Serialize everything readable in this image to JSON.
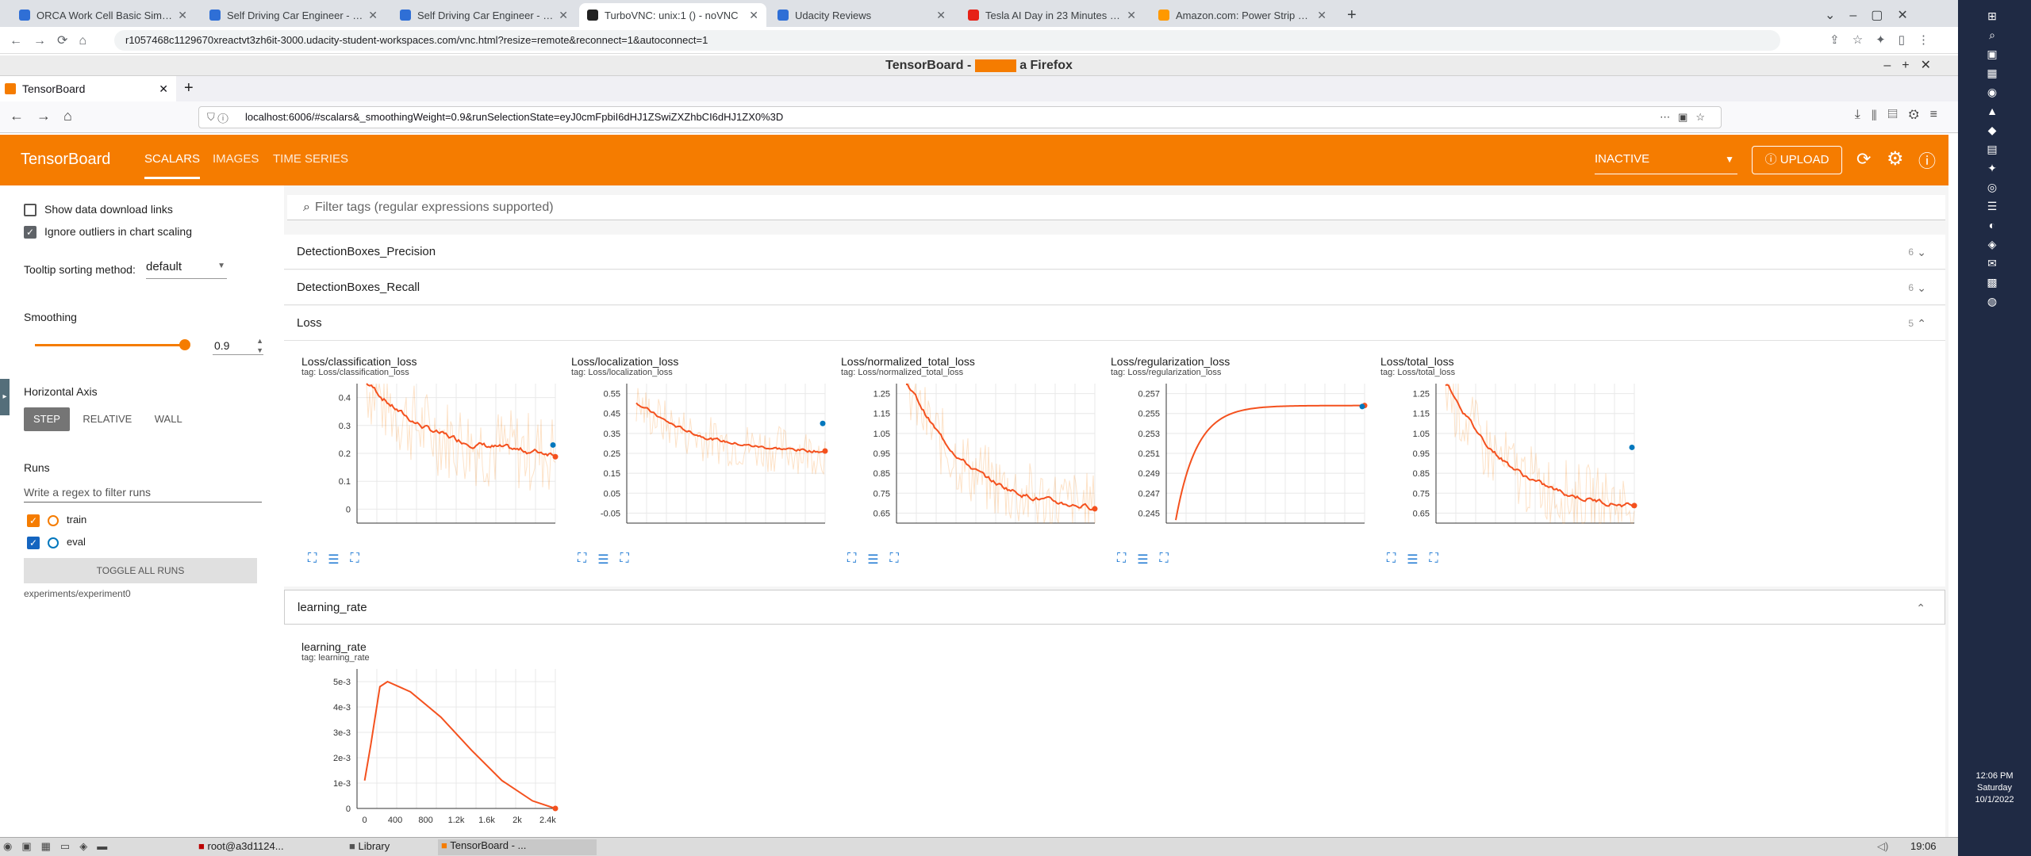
{
  "chrome": {
    "tabs": [
      "ORCA Work Cell Basic Simulatio",
      "Self Driving Car Engineer - Udac",
      "Self Driving Car Engineer - Udac",
      "TurboVNC: unix:1 () - noVNC",
      "Udacity Reviews",
      "Tesla AI Day in 23 Minutes (Supe",
      "Amazon.com: Power Strip with 6"
    ],
    "url": "r1057468c1129670xreactvt3zh6it-3000.udacity-student-workspaces.com/vnc.html?resize=remote&reconnect=1&autoconnect=1"
  },
  "firefox": {
    "window_title_left": "TensorBoard -",
    "window_title_right": "a Firefox",
    "tab_title": "TensorBoard",
    "url": "localhost:6006/#scalars&_smoothingWeight=0.9&runSelectionState=eyJ0cmFpbiI6dHJ1ZSwiZXZhbCI6dHJ1ZX0%3D"
  },
  "tensorboard": {
    "logo": "TensorBoard",
    "tabs": [
      "SCALARS",
      "IMAGES",
      "TIME SERIES"
    ],
    "inactive_label": "INACTIVE",
    "upload_label": "UPLOAD",
    "accent_color": "#f57c00"
  },
  "sidebar": {
    "show_download_links": "Show data download links",
    "ignore_outliers": "Ignore outliers in chart scaling",
    "tooltip_label": "Tooltip sorting method:",
    "tooltip_value": "default",
    "smoothing_label": "Smoothing",
    "smoothing_value": "0.9",
    "haxis_label": "Horizontal Axis",
    "haxis": [
      "STEP",
      "RELATIVE",
      "WALL"
    ],
    "runs_label": "Runs",
    "runs_filter_placeholder": "Write a regex to filter runs",
    "runs": [
      "train",
      "eval"
    ],
    "toggle_all": "TOGGLE ALL RUNS",
    "experiment": "experiments/experiment0"
  },
  "main": {
    "filter_placeholder": "Filter tags (regular expressions supported)",
    "groups": [
      {
        "name": "DetectionBoxes_Precision",
        "count": "6"
      },
      {
        "name": "DetectionBoxes_Recall",
        "count": "6"
      },
      {
        "name": "Loss",
        "count": "5"
      },
      {
        "name": "learning_rate"
      }
    ]
  },
  "chart_data": [
    {
      "type": "line",
      "title": "Loss/classification_loss",
      "subtitle": "tag: Loss/classification_loss",
      "yticks": [
        "0.4",
        "0.3",
        "0.2",
        "0.1",
        "0"
      ],
      "ylim": [
        -0.05,
        0.45
      ],
      "series": [
        {
          "name": "train",
          "shape": "decay",
          "start": 0.45,
          "end": 0.19,
          "noise": 0.05
        }
      ],
      "eval_point": 0.23
    },
    {
      "type": "line",
      "title": "Loss/localization_loss",
      "subtitle": "tag: Loss/localization_loss",
      "yticks": [
        "0.55",
        "0.45",
        "0.35",
        "0.25",
        "0.15",
        "0.05",
        "-0.05"
      ],
      "ylim": [
        -0.1,
        0.6
      ],
      "series": [
        {
          "name": "train",
          "shape": "decay",
          "start": 0.5,
          "end": 0.25,
          "noise": 0.04
        }
      ],
      "eval_point": 0.4
    },
    {
      "type": "line",
      "title": "Loss/normalized_total_loss",
      "subtitle": "tag: Loss/normalized_total_loss",
      "yticks": [
        "1.25",
        "1.15",
        "1.05",
        "0.95",
        "0.85",
        "0.75",
        "0.65"
      ],
      "ylim": [
        0.6,
        1.3
      ],
      "series": [
        {
          "name": "train",
          "shape": "decay",
          "start": 1.3,
          "end": 0.65,
          "noise": 0.06
        }
      ],
      "eval_point": null
    },
    {
      "type": "line",
      "title": "Loss/regularization_loss",
      "subtitle": "tag: Loss/regularization_loss",
      "yticks": [
        "0.257",
        "0.255",
        "0.253",
        "0.251",
        "0.249",
        "0.247",
        "0.245"
      ],
      "ylim": [
        0.244,
        0.258
      ],
      "series": [
        {
          "name": "train",
          "shape": "rise",
          "start": 0.2443,
          "end": 0.2558,
          "noise": 0
        }
      ],
      "eval_point": 0.2557
    },
    {
      "type": "line",
      "title": "Loss/total_loss",
      "subtitle": "tag: Loss/total_loss",
      "yticks": [
        "1.25",
        "1.15",
        "1.05",
        "0.95",
        "0.85",
        "0.75",
        "0.65"
      ],
      "ylim": [
        0.6,
        1.3
      ],
      "series": [
        {
          "name": "train",
          "shape": "decay",
          "start": 1.3,
          "end": 0.66,
          "noise": 0.06
        }
      ],
      "eval_point": 0.98
    },
    {
      "type": "line",
      "title": "learning_rate",
      "subtitle": "tag: learning_rate",
      "yticks": [
        "5e-3",
        "4e-3",
        "3e-3",
        "2e-3",
        "1e-3",
        "0"
      ],
      "xticks": [
        "0",
        "400",
        "800",
        "1.2k",
        "1.6k",
        "2k",
        "2.4k"
      ],
      "ylim": [
        0,
        0.0055
      ],
      "xlim": [
        -100,
        2500
      ],
      "series": [
        {
          "name": "train",
          "shape": "warmup-cosine",
          "x": [
            0,
            80,
            200,
            300,
            600,
            1000,
            1400,
            1800,
            2200,
            2500
          ],
          "y": [
            0.0011,
            0.0025,
            0.0048,
            0.005,
            0.0046,
            0.0036,
            0.0023,
            0.0011,
            0.0003,
            0.0
          ]
        }
      ],
      "eval_point": null
    }
  ],
  "taskbar": {
    "items": [
      "root@a3d1124...",
      "Library",
      "TensorBoard - ..."
    ],
    "clock": "19:06"
  },
  "windows": {
    "time": "12:06 PM",
    "day": "Saturday",
    "date": "10/1/2022"
  }
}
